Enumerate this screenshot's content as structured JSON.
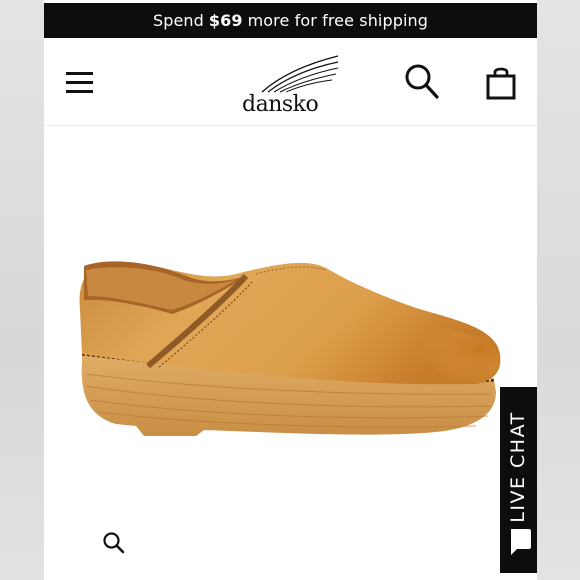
{
  "promo": {
    "prefix": "Spend",
    "amount": "$69",
    "suffix": "more for free shipping"
  },
  "header": {
    "logo_text": "dansko",
    "menu_icon": "hamburger-menu-icon",
    "search_icon": "search-icon",
    "cart_icon": "shopping-bag-icon"
  },
  "product": {
    "image": "tan-leather-clog",
    "zoom_icon": "zoom-icon"
  },
  "live_chat": {
    "label": "LIVE CHAT",
    "icon": "chat-bubble-icon"
  },
  "colors": {
    "promo_bg": "#0d0d0d",
    "chat_bg": "#0d0d0d",
    "shoe_leather": "#d99a3e",
    "shoe_sole": "#d9a35a"
  }
}
